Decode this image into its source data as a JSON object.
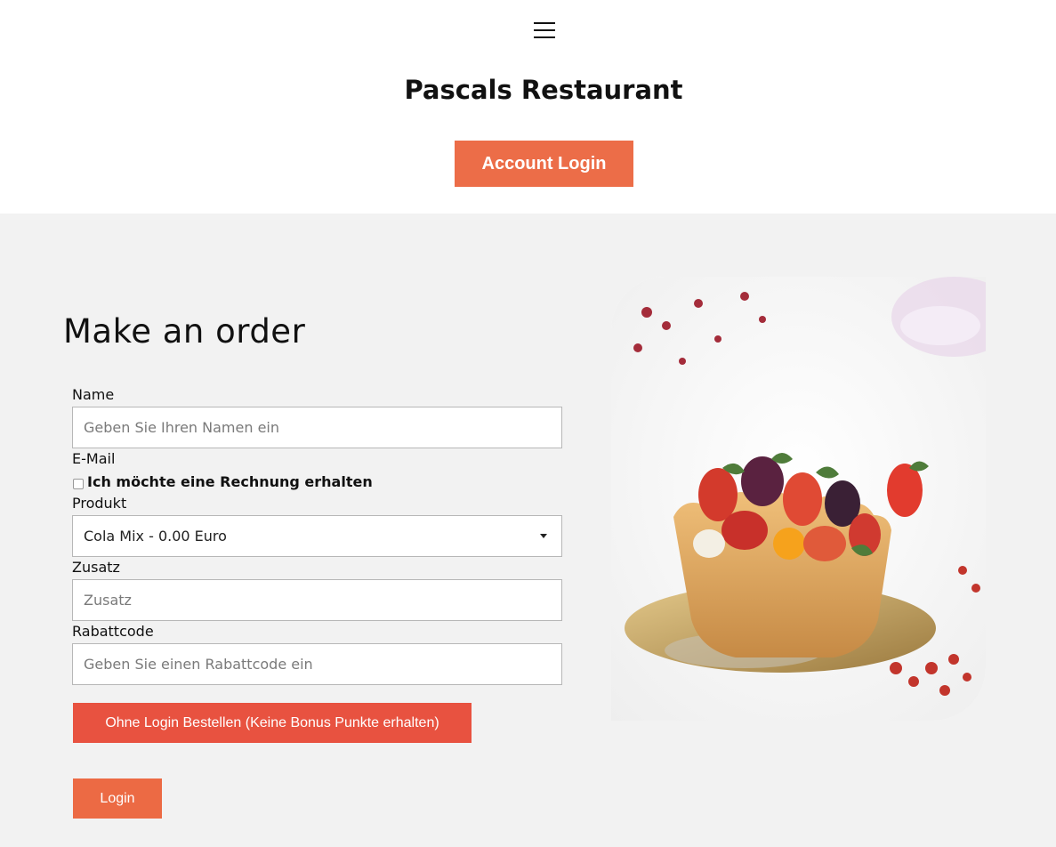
{
  "header": {
    "title": "Pascals Restaurant",
    "account_login_label": "Account Login"
  },
  "order": {
    "heading": "Make an order",
    "name_label": "Name",
    "name_placeholder": "Geben Sie Ihren Namen ein",
    "email_label": "E-Mail",
    "invoice_checkbox_label": "Ich möchte eine Rechnung erhalten",
    "invoice_checked": false,
    "product_label": "Produkt",
    "product_selected": "Cola Mix - 0.00 Euro",
    "extra_label": "Zusatz",
    "extra_placeholder": "Zusatz",
    "discount_label": "Rabattcode",
    "discount_placeholder": "Geben Sie einen Rabattcode ein",
    "order_button_label": "Ohne Login Bestellen (Keine Bonus Punkte erhalten)",
    "login_button_label": "Login"
  },
  "colors": {
    "accent": "#ec6d48",
    "order_button": "#e85240",
    "section_background": "#f2f2f2"
  },
  "icons": [
    "hamburger-menu-icon",
    "chevron-down-icon"
  ]
}
